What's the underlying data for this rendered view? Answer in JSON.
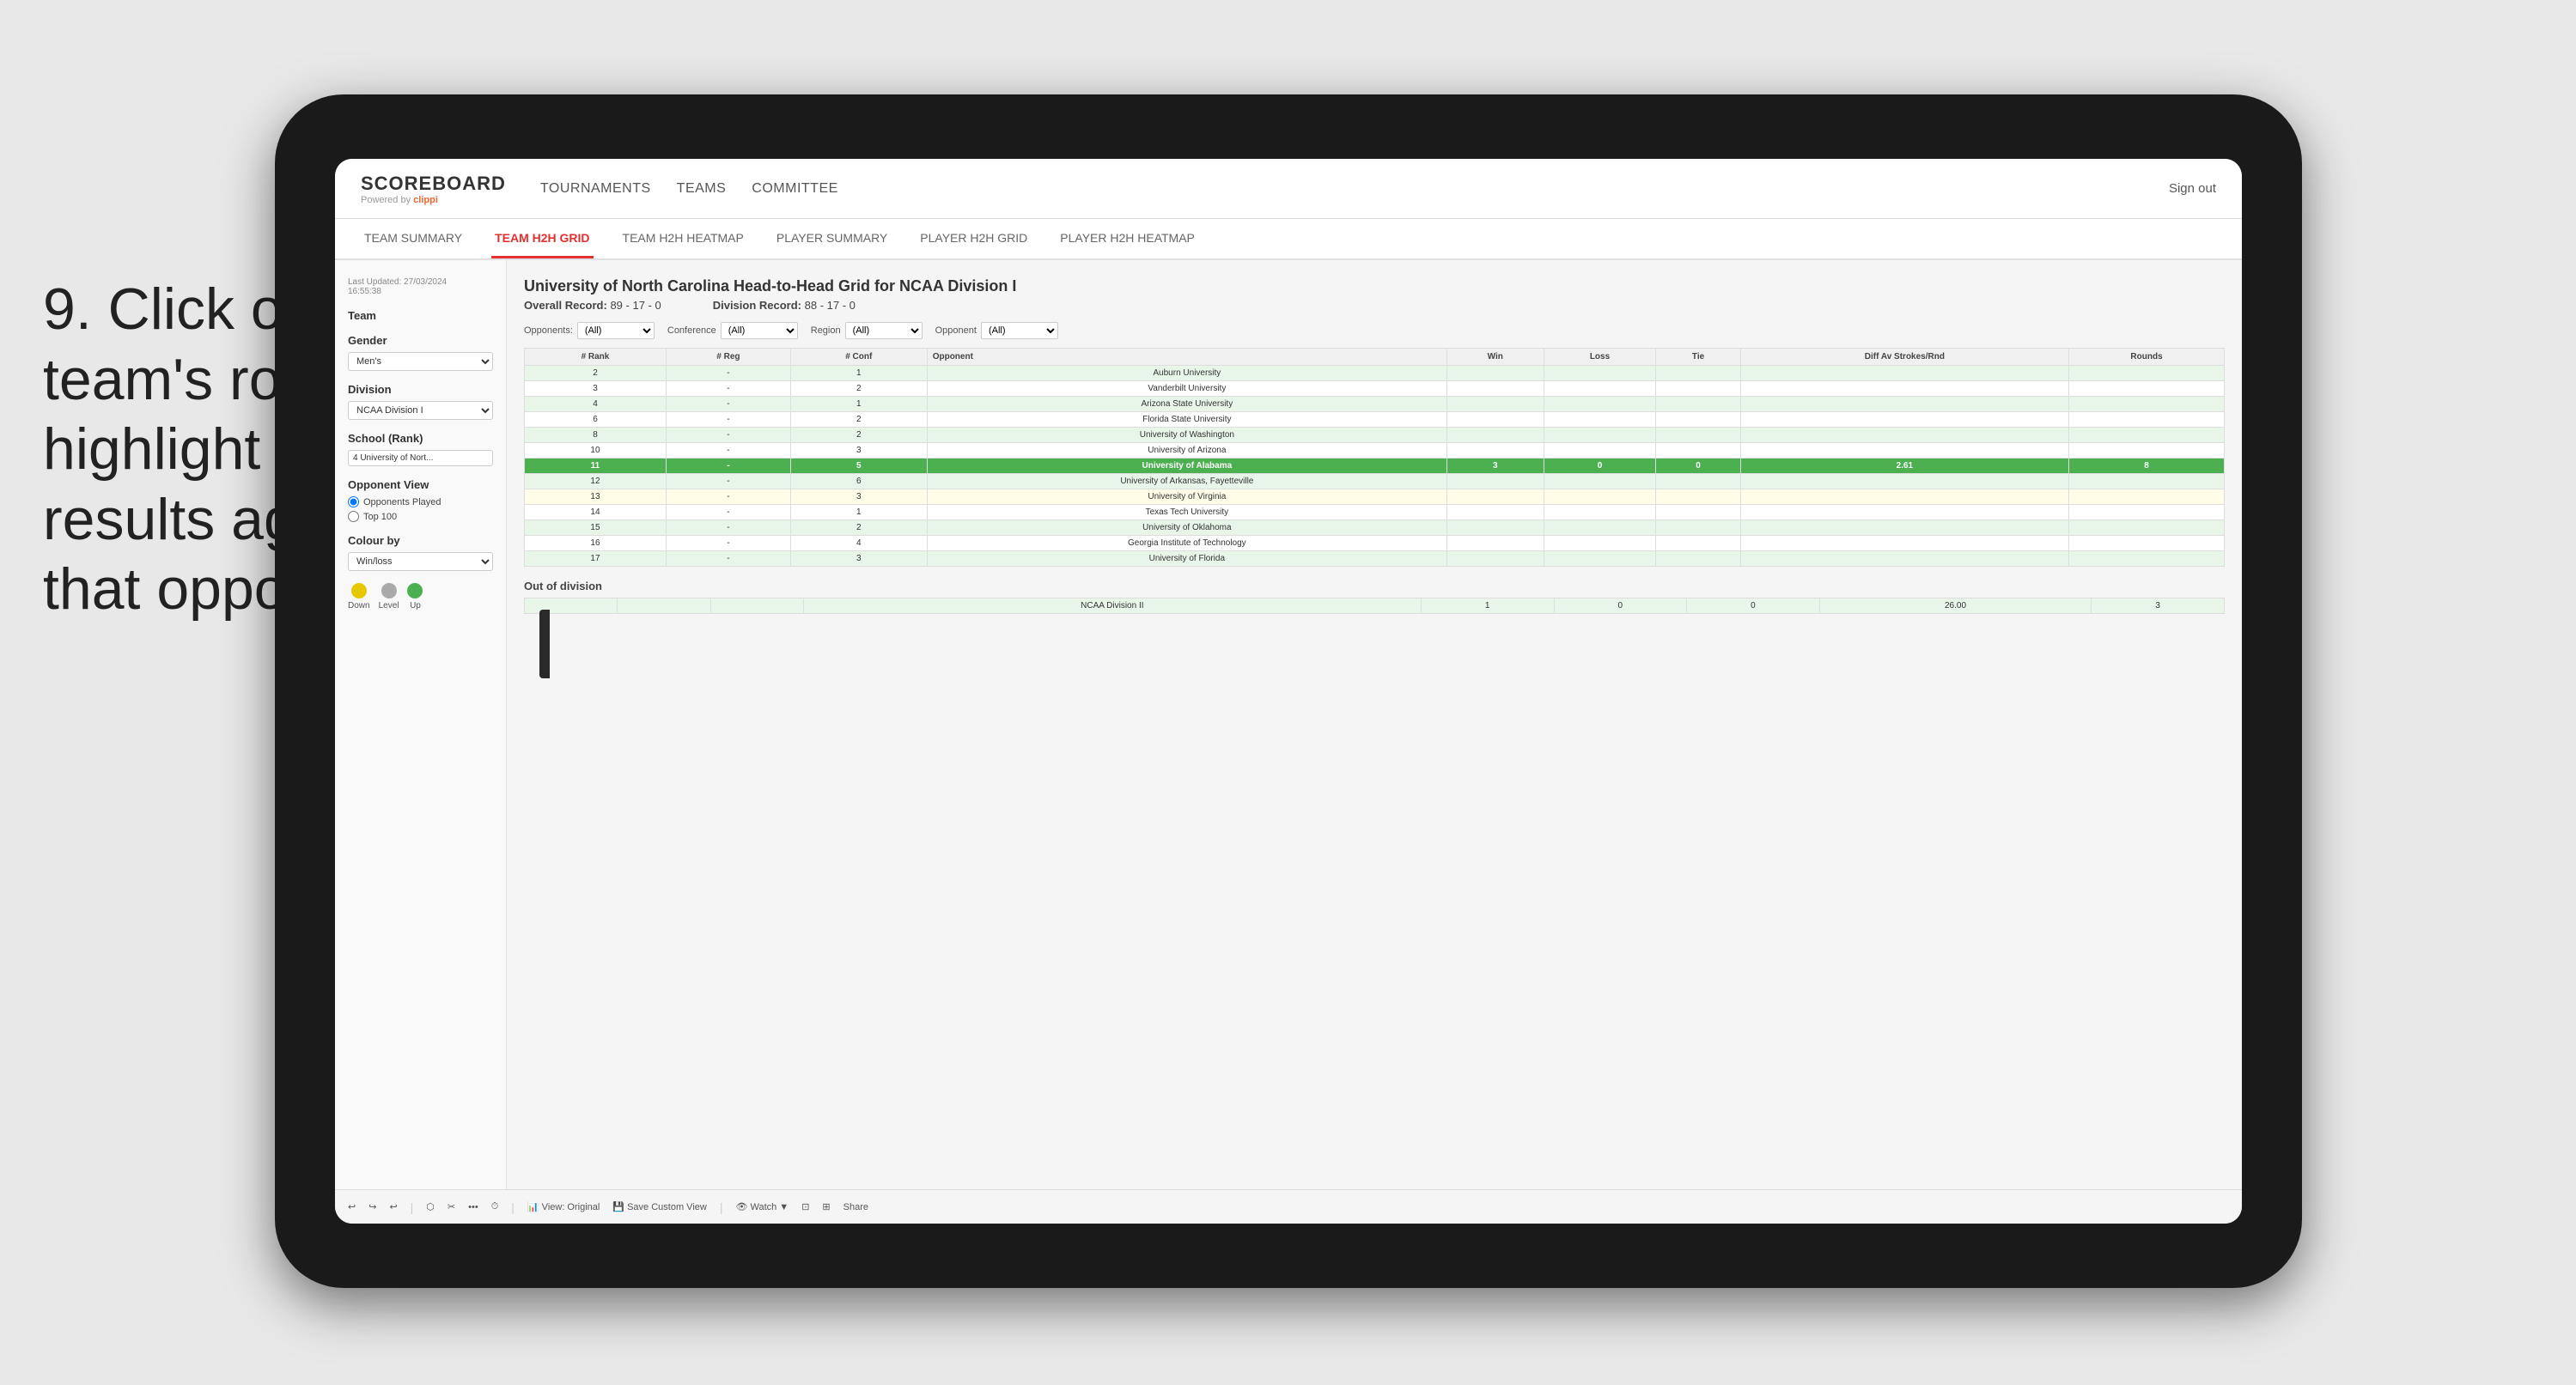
{
  "instruction": {
    "number": "9.",
    "text": "Click on a team's row to highlight results against that opponent"
  },
  "app": {
    "logo": "SCOREBOARD",
    "powered_by": "Powered by clippi",
    "nav": {
      "items": [
        "TOURNAMENTS",
        "TEAMS",
        "COMMITTEE"
      ],
      "sign_out": "Sign out"
    },
    "sub_nav": {
      "items": [
        "TEAM SUMMARY",
        "TEAM H2H GRID",
        "TEAM H2H HEATMAP",
        "PLAYER SUMMARY",
        "PLAYER H2H GRID",
        "PLAYER H2H HEATMAP"
      ],
      "active": "TEAM H2H GRID"
    }
  },
  "sidebar": {
    "timestamp_label": "Last Updated: 27/03/2024",
    "timestamp_time": "16:55:38",
    "team_label": "Team",
    "gender_label": "Gender",
    "gender_value": "Men's",
    "division_label": "Division",
    "division_value": "NCAA Division I",
    "school_label": "School (Rank)",
    "school_value": "4 University of Nort...",
    "opponent_view_label": "Opponent View",
    "radio_options": [
      "Opponents Played",
      "Top 100"
    ],
    "radio_selected": "Opponents Played",
    "colour_by_label": "Colour by",
    "colour_by_value": "Win/loss",
    "legend": {
      "items": [
        {
          "label": "Down",
          "color": "yellow"
        },
        {
          "label": "Level",
          "color": "gray"
        },
        {
          "label": "Up",
          "color": "green"
        }
      ]
    }
  },
  "grid": {
    "title": "University of North Carolina Head-to-Head Grid for NCAA Division I",
    "overall_record_label": "Overall Record:",
    "overall_record": "89 - 17 - 0",
    "division_record_label": "Division Record:",
    "division_record": "88 - 17 - 0",
    "filters": {
      "opponents_label": "Opponents:",
      "opponents_value": "(All)",
      "conference_label": "Conference",
      "conference_value": "(All)",
      "region_label": "Region",
      "region_value": "(All)",
      "opponent_label": "Opponent",
      "opponent_value": "(All)"
    },
    "table": {
      "headers": [
        "# Rank",
        "# Reg",
        "# Conf",
        "Opponent",
        "Win",
        "Loss",
        "Tie",
        "Diff Av Strokes/Rnd",
        "Rounds"
      ],
      "rows": [
        {
          "rank": "2",
          "reg": "-",
          "conf": "1",
          "opponent": "Auburn University",
          "win": "",
          "loss": "",
          "tie": "",
          "diff": "",
          "rounds": "",
          "style": "light-green"
        },
        {
          "rank": "3",
          "reg": "-",
          "conf": "2",
          "opponent": "Vanderbilt University",
          "win": "",
          "loss": "",
          "tie": "",
          "diff": "",
          "rounds": "",
          "style": "white"
        },
        {
          "rank": "4",
          "reg": "-",
          "conf": "1",
          "opponent": "Arizona State University",
          "win": "",
          "loss": "",
          "tie": "",
          "diff": "",
          "rounds": "",
          "style": "light-green"
        },
        {
          "rank": "6",
          "reg": "-",
          "conf": "2",
          "opponent": "Florida State University",
          "win": "",
          "loss": "",
          "tie": "",
          "diff": "",
          "rounds": "",
          "style": "white"
        },
        {
          "rank": "8",
          "reg": "-",
          "conf": "2",
          "opponent": "University of Washington",
          "win": "",
          "loss": "",
          "tie": "",
          "diff": "",
          "rounds": "",
          "style": "light-green"
        },
        {
          "rank": "10",
          "reg": "-",
          "conf": "3",
          "opponent": "University of Arizona",
          "win": "",
          "loss": "",
          "tie": "",
          "diff": "",
          "rounds": "",
          "style": "white"
        },
        {
          "rank": "11",
          "reg": "-",
          "conf": "5",
          "opponent": "University of Alabama",
          "win": "3",
          "loss": "0",
          "tie": "0",
          "diff": "2.61",
          "rounds": "8",
          "style": "highlighted"
        },
        {
          "rank": "12",
          "reg": "-",
          "conf": "6",
          "opponent": "University of Arkansas, Fayetteville",
          "win": "",
          "loss": "",
          "tie": "",
          "diff": "",
          "rounds": "",
          "style": "light-green"
        },
        {
          "rank": "13",
          "reg": "-",
          "conf": "3",
          "opponent": "University of Virginia",
          "win": "",
          "loss": "",
          "tie": "",
          "diff": "",
          "rounds": "",
          "style": "light-yellow"
        },
        {
          "rank": "14",
          "reg": "-",
          "conf": "1",
          "opponent": "Texas Tech University",
          "win": "",
          "loss": "",
          "tie": "",
          "diff": "",
          "rounds": "",
          "style": "white"
        },
        {
          "rank": "15",
          "reg": "-",
          "conf": "2",
          "opponent": "University of Oklahoma",
          "win": "",
          "loss": "",
          "tie": "",
          "diff": "",
          "rounds": "",
          "style": "light-green"
        },
        {
          "rank": "16",
          "reg": "-",
          "conf": "4",
          "opponent": "Georgia Institute of Technology",
          "win": "",
          "loss": "",
          "tie": "",
          "diff": "",
          "rounds": "",
          "style": "white"
        },
        {
          "rank": "17",
          "reg": "-",
          "conf": "3",
          "opponent": "University of Florida",
          "win": "",
          "loss": "",
          "tie": "",
          "diff": "",
          "rounds": "",
          "style": "light-green"
        }
      ]
    },
    "out_of_division_label": "Out of division",
    "out_of_division_row": {
      "opponent": "NCAA Division II",
      "win": "1",
      "loss": "0",
      "tie": "0",
      "diff": "26.00",
      "rounds": "3"
    }
  },
  "toolbar": {
    "items": [
      "↩",
      "↪",
      "↩",
      "⬡",
      "✂",
      "·",
      "⏱",
      "View: Original",
      "Save Custom View",
      "Watch ▼",
      "⊡",
      "⊞",
      "Share"
    ]
  }
}
